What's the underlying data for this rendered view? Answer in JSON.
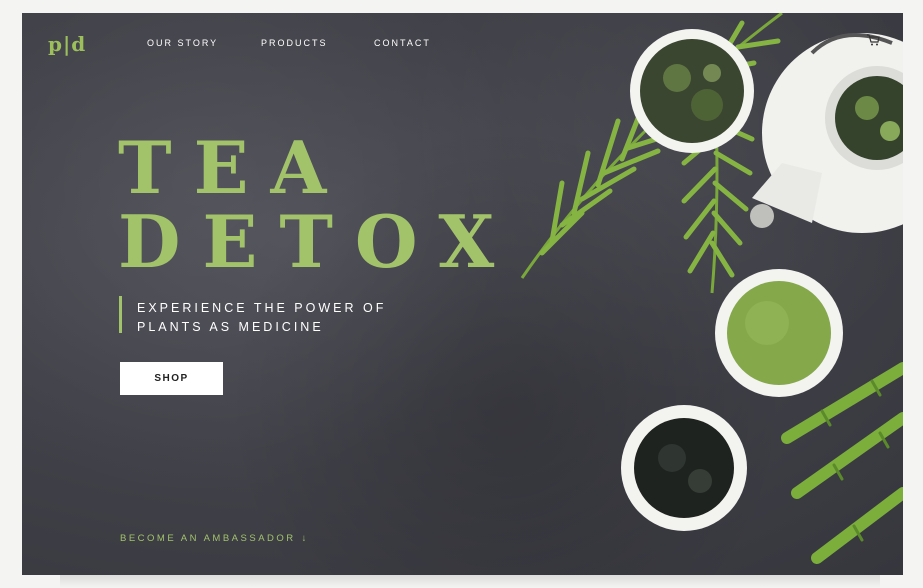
{
  "brand": {
    "logo": "p|d"
  },
  "nav": {
    "items": [
      "OUR STORY",
      "PRODUCTS",
      "CONTACT"
    ]
  },
  "hero": {
    "title_line1": "TEA",
    "title_line2": "DETOX",
    "tagline_line1": "EXPERIENCE THE POWER OF",
    "tagline_line2": "PLANTS AS MEDICINE",
    "shop_label": "SHOP",
    "ambassador_label": "BECOME AN AMBASSADOR",
    "ambassador_arrow": "↓"
  },
  "icons": {
    "cart": "cart-icon",
    "scroll": "arrow-down-icon"
  },
  "colors": {
    "accent": "#a2c36a",
    "background": "#43434b",
    "text": "#ffffff",
    "button_bg": "#ffffff"
  }
}
